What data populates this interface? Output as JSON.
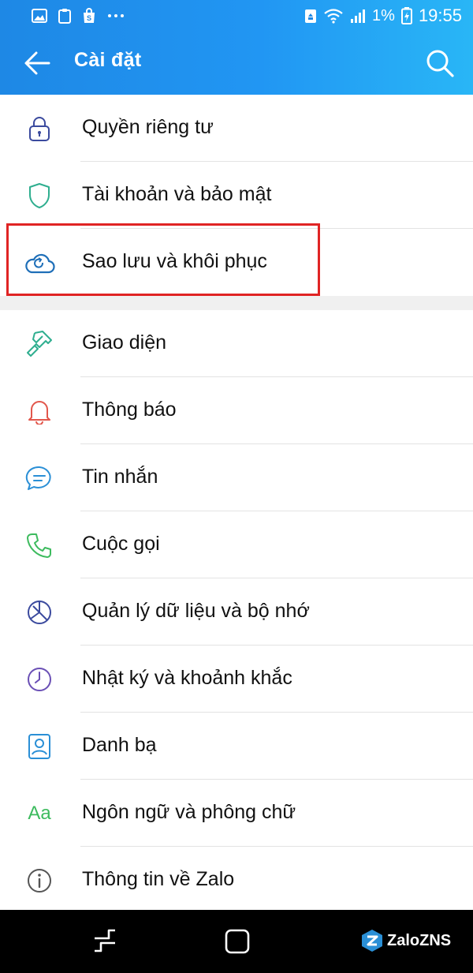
{
  "status_bar": {
    "battery_text": "1%",
    "time": "19:55",
    "left_icons": [
      "image-icon",
      "clipboard-icon",
      "shop-icon",
      "more-dots-icon"
    ],
    "right_icons": [
      "recycle-icon",
      "wifi-icon",
      "signal-icon",
      "battery-icon"
    ]
  },
  "header": {
    "title": "Cài đặt",
    "back_icon": "arrow-left-icon",
    "search_icon": "search-icon"
  },
  "settings": {
    "group1": [
      {
        "label": "Quyền riêng tư",
        "icon": "lock-icon"
      },
      {
        "label": "Tài khoản và bảo mật",
        "icon": "shield-icon"
      },
      {
        "label": "Sao lưu và khôi phục",
        "icon": "cloud-sync-icon"
      }
    ],
    "group2": [
      {
        "label": "Giao diện",
        "icon": "paint-brush-icon"
      },
      {
        "label": "Thông báo",
        "icon": "bell-icon"
      },
      {
        "label": "Tin nhắn",
        "icon": "chat-bubble-icon"
      },
      {
        "label": "Cuộc gọi",
        "icon": "phone-icon"
      },
      {
        "label": "Quản lý dữ liệu và bộ nhớ",
        "icon": "pie-chart-icon"
      },
      {
        "label": "Nhật ký và khoảnh khắc",
        "icon": "clock-icon"
      },
      {
        "label": "Danh bạ",
        "icon": "contact-card-icon"
      },
      {
        "label": "Ngôn ngữ và phông chữ",
        "icon": "font-aa-icon",
        "icon_text": "Aa"
      },
      {
        "label": "Thông tin về Zalo",
        "icon": "info-icon"
      }
    ]
  },
  "highlight_color": "#e02424",
  "accent_color": "#2196f3",
  "watermark": {
    "text": "ZaloZNS"
  }
}
